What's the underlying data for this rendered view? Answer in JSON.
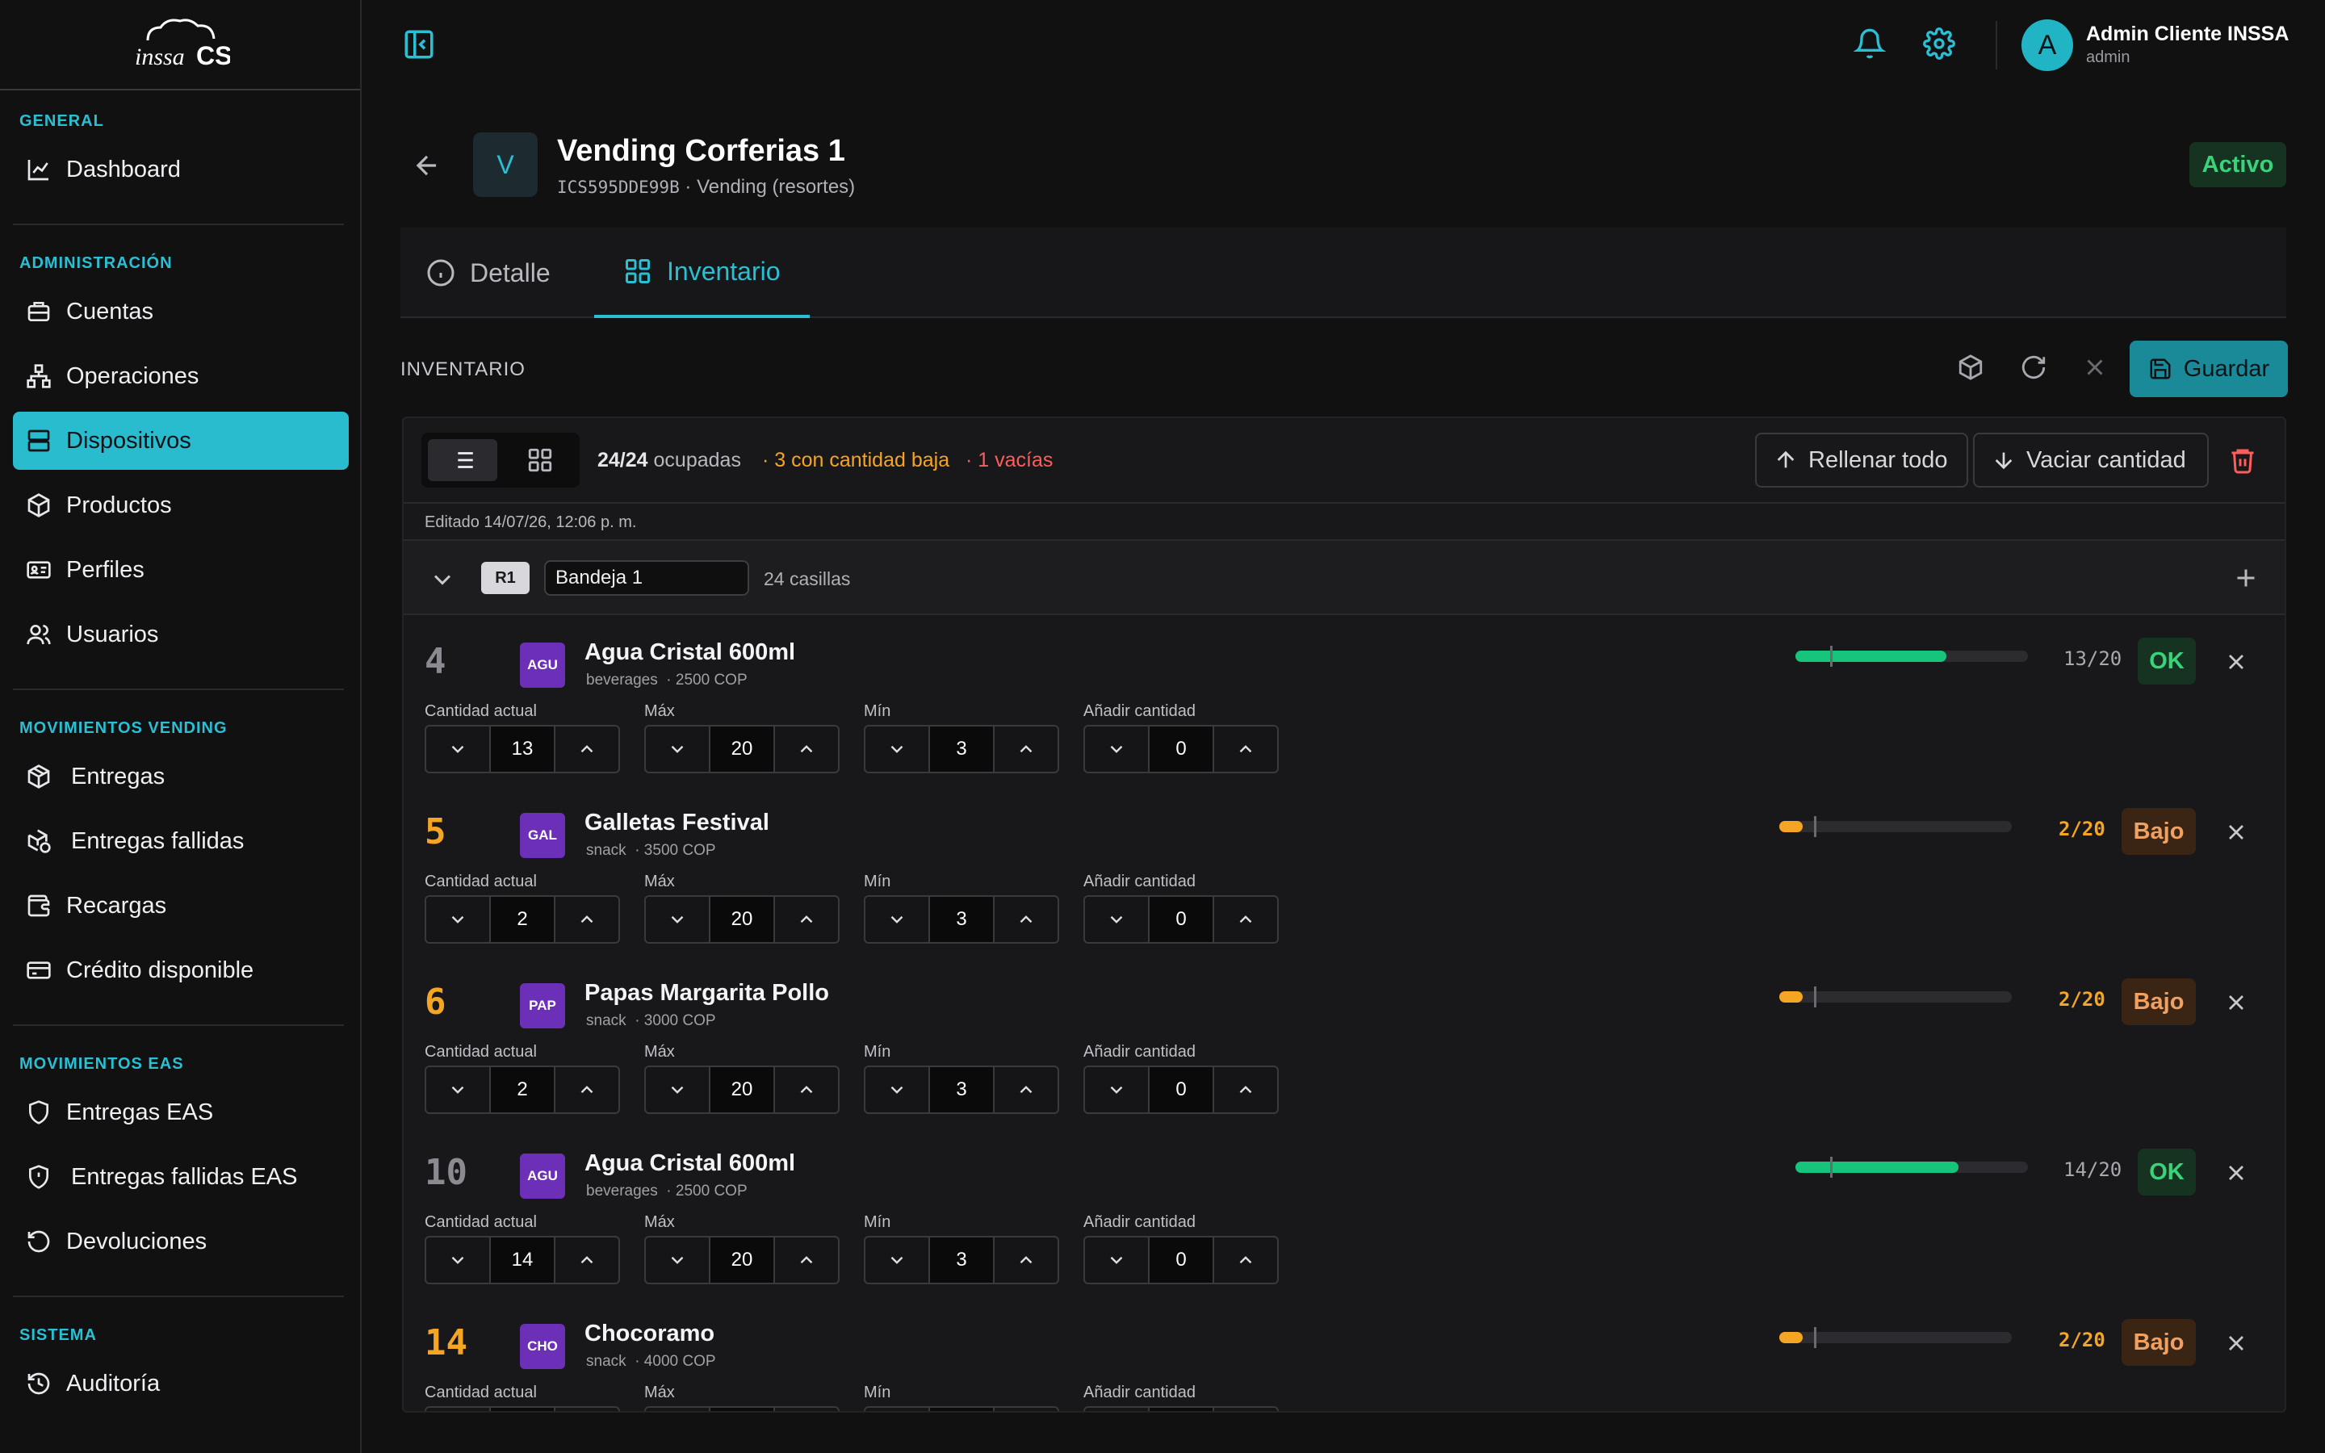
{
  "app": {
    "logo_text": "inssa CS"
  },
  "sidebar": {
    "sections": [
      {
        "title": "GENERAL",
        "items": [
          {
            "label": "Dashboard",
            "icon": "chart-line-icon"
          }
        ]
      },
      {
        "title": "ADMINISTRACIÓN",
        "items": [
          {
            "label": "Cuentas",
            "icon": "briefcase-icon"
          },
          {
            "label": "Operaciones",
            "icon": "network-icon"
          },
          {
            "label": "Dispositivos",
            "icon": "server-icon",
            "active": true
          },
          {
            "label": "Productos",
            "icon": "box-icon"
          },
          {
            "label": "Perfiles",
            "icon": "id-card-icon"
          },
          {
            "label": "Usuarios",
            "icon": "users-icon"
          }
        ]
      },
      {
        "title": "MOVIMIENTOS VENDING",
        "items": [
          {
            "label": "Entregas",
            "icon": "package-icon"
          },
          {
            "label": "Entregas fallidas",
            "icon": "package-error-icon"
          },
          {
            "label": "Recargas",
            "icon": "wallet-icon"
          },
          {
            "label": "Crédito disponible",
            "icon": "credit-card-icon"
          }
        ]
      },
      {
        "title": "MOVIMIENTOS EAS",
        "items": [
          {
            "label": "Entregas EAS",
            "icon": "shield-icon"
          },
          {
            "label": "Entregas fallidas EAS",
            "icon": "shield-alert-icon"
          },
          {
            "label": "Devoluciones",
            "icon": "undo-icon"
          }
        ]
      },
      {
        "title": "SISTEMA",
        "items": [
          {
            "label": "Auditoría",
            "icon": "history-icon"
          }
        ]
      }
    ]
  },
  "user": {
    "initial": "A",
    "name": "Admin Cliente INSSA",
    "role": "admin"
  },
  "device": {
    "initial": "V",
    "title": "Vending Corferias 1",
    "code": "ICS595DDE99B",
    "separator": "·",
    "type": "Vending (resortes)",
    "status": "Activo"
  },
  "tabs": [
    {
      "label": "Detalle",
      "icon": "info-icon"
    },
    {
      "label": "Inventario",
      "icon": "grid-icon",
      "active": true
    }
  ],
  "inventory": {
    "title": "INVENTARIO",
    "save_label": "Guardar",
    "occupied": "24/24",
    "occupied_suffix": "ocupadas",
    "low_text": "· 3 con cantidad baja",
    "empty_text": "· 1 vacías",
    "fill_all_label": "Rellenar todo",
    "empty_qty_label": "Vaciar cantidad",
    "edited": "Editado 14/07/26, 12:06 p. m.",
    "tray": {
      "badge": "R1",
      "name": "Bandeja 1",
      "count": "24 casillas"
    },
    "field_labels": {
      "current": "Cantidad actual",
      "max": "Máx",
      "min": "Mín",
      "add": "Añadir cantidad"
    },
    "slots": [
      {
        "number": "4",
        "icon_text": "AGU",
        "name": "Agua Cristal 600ml",
        "category": "beverages",
        "price": "· 2500 COP",
        "current": "13",
        "max": "20",
        "min": "3",
        "add": "0",
        "count": "13/20",
        "status": "OK",
        "level": "ok",
        "fill_fraction": 0.65
      },
      {
        "number": "5",
        "icon_text": "GAL",
        "name": "Galletas Festival",
        "category": "snack",
        "price": "· 3500 COP",
        "current": "2",
        "max": "20",
        "min": "3",
        "add": "0",
        "count": "2/20",
        "status": "Bajo",
        "level": "low",
        "fill_fraction": 0.1
      },
      {
        "number": "6",
        "icon_text": "PAP",
        "name": "Papas Margarita Pollo",
        "category": "snack",
        "price": "· 3000 COP",
        "current": "2",
        "max": "20",
        "min": "3",
        "add": "0",
        "count": "2/20",
        "status": "Bajo",
        "level": "low",
        "fill_fraction": 0.1
      },
      {
        "number": "10",
        "icon_text": "AGU",
        "name": "Agua Cristal 600ml",
        "category": "beverages",
        "price": "· 2500 COP",
        "current": "14",
        "max": "20",
        "min": "3",
        "add": "0",
        "count": "14/20",
        "status": "OK",
        "level": "ok",
        "fill_fraction": 0.7
      },
      {
        "number": "14",
        "icon_text": "CHO",
        "name": "Chocoramo",
        "category": "snack",
        "price": "· 4000 COP",
        "current": "",
        "max": "",
        "min": "",
        "add": "",
        "count": "2/20",
        "status": "Bajo",
        "level": "low",
        "fill_fraction": 0.1
      }
    ]
  },
  "colors": {
    "accent": "#2bbfd4",
    "ok": "#17c47b",
    "low": "#f5a524",
    "danger": "#ff5c5c",
    "product_icon": "#6c30b8"
  }
}
